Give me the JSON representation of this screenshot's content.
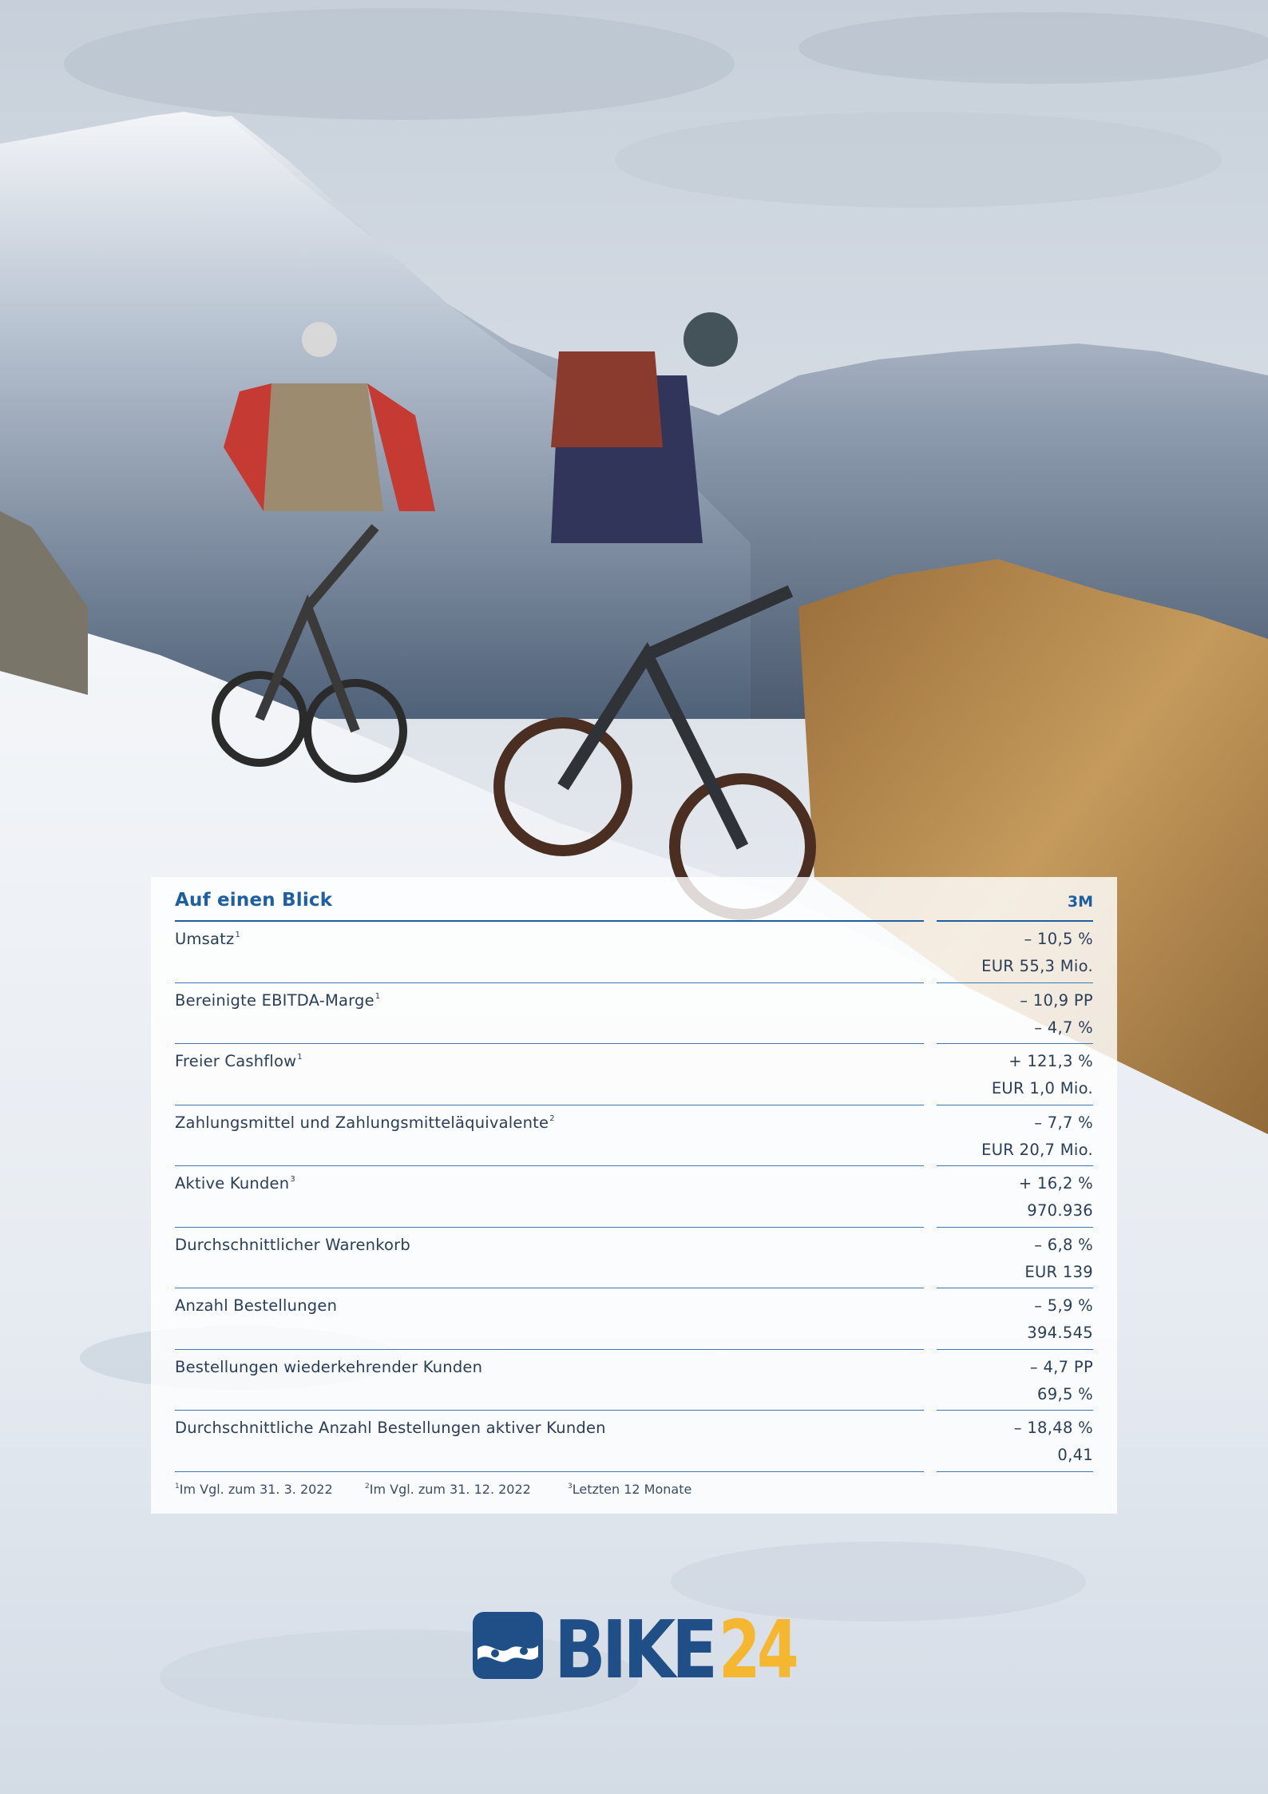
{
  "table": {
    "title": "Auf einen Blick",
    "period": "3M",
    "rows": [
      {
        "label": "Umsatz",
        "note": "1",
        "change": "– 10,5 %",
        "value": "EUR 55,3 Mio."
      },
      {
        "label": "Bereinigte EBITDA-Marge",
        "note": "1",
        "change": "– 10,9 PP",
        "value": "– 4,7 %"
      },
      {
        "label": "Freier Cashflow",
        "note": "1",
        "change": "+ 121,3 %",
        "value": "EUR 1,0 Mio."
      },
      {
        "label": "Zahlungsmittel und Zahlungsmitteläquivalente",
        "note": "2",
        "change": "– 7,7 %",
        "value": "EUR 20,7 Mio."
      },
      {
        "label": "Aktive Kunden",
        "note": "3",
        "change": "+ 16,2 %",
        "value": "970.936"
      },
      {
        "label": "Durchschnittlicher Warenkorb",
        "note": "",
        "change": "– 6,8 %",
        "value": "EUR 139"
      },
      {
        "label": "Anzahl Bestellungen",
        "note": "",
        "change": "– 5,9 %",
        "value": "394.545"
      },
      {
        "label": "Bestellungen wiederkehrender Kunden",
        "note": "",
        "change": "– 4,7 PP",
        "value": "69,5 %"
      },
      {
        "label": "Durchschnittliche Anzahl Bestellungen aktiver Kunden",
        "note": "",
        "change": "– 18,48 %",
        "value": "0,41"
      }
    ],
    "footnotes": [
      {
        "mark": "1",
        "text": "Im Vgl. zum 31. 3. 2022"
      },
      {
        "mark": "2",
        "text": "Im Vgl. zum 31. 12. 2022"
      },
      {
        "mark": "3",
        "text": "Letzten 12 Monate"
      }
    ]
  },
  "logo": {
    "name": "BIKE24",
    "text_main": "BIKE",
    "text_accent": "24",
    "color_main": "#1f4f86",
    "color_accent": "#f5b630"
  },
  "colors": {
    "accent_blue": "#1d5fa0",
    "sky": "#d8e0e8",
    "snow": "#eef2f6",
    "mountain": "#6d7d91",
    "grass": "#b88a4e"
  },
  "photo": {
    "subject": "mountain-bikers-on-snowy-ridge"
  }
}
